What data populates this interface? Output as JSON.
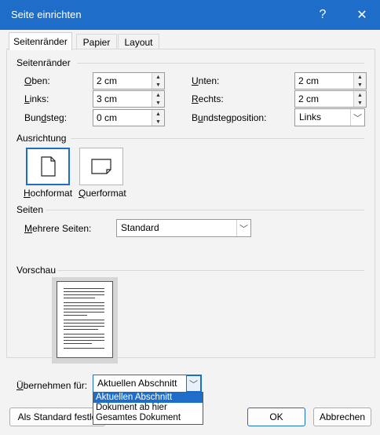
{
  "window": {
    "title": "Seite einrichten",
    "help_label": "?",
    "close_label": "✕"
  },
  "tabs": [
    "Seitenränder",
    "Papier",
    "Layout"
  ],
  "margins": {
    "group_label": "Seitenränder",
    "top_label": "Oben:",
    "top_value": "2 cm",
    "bottom_label": "Unten:",
    "bottom_value": "2 cm",
    "left_label": "Links:",
    "left_value": "3 cm",
    "right_label": "Rechts:",
    "right_value": "2 cm",
    "gutter_label": "Bundsteg:",
    "gutter_value": "0 cm",
    "gutter_pos_label": "Bundstegposition:",
    "gutter_pos_value": "Links"
  },
  "orientation": {
    "group_label": "Ausrichtung",
    "portrait_label": "Hochformat",
    "landscape_label": "Querformat",
    "selected": "portrait"
  },
  "pages": {
    "group_label": "Seiten",
    "multiple_label": "Mehrere Seiten:",
    "multiple_value": "Standard"
  },
  "preview": {
    "group_label": "Vorschau"
  },
  "apply": {
    "label": "Übernehmen für:",
    "value": "Aktuellen Abschnitt",
    "options": [
      "Aktuellen Abschnitt",
      "Dokument ab hier",
      "Gesamtes Dokument"
    ]
  },
  "footer": {
    "default_button": "Als Standard festle",
    "ok_button": "OK",
    "cancel_button": "Abbrechen"
  },
  "colors": {
    "accent": "#1e6ec9",
    "background": "#f3f3f3"
  }
}
